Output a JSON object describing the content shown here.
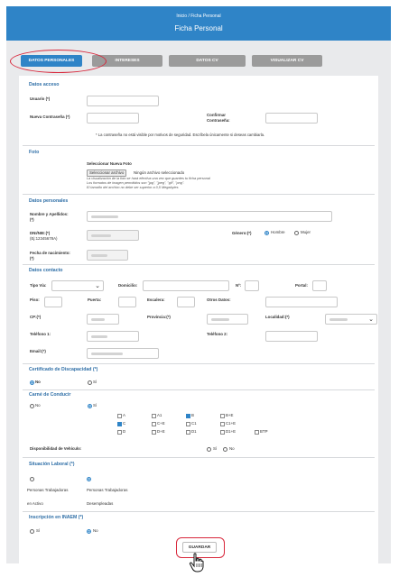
{
  "header": {
    "breadcrumb": "Inicio / Ficha Personal",
    "title": "Ficha Personal"
  },
  "tabs": [
    "DATOS PERSONALES",
    "INTERESES",
    "DATOS CV",
    "VISUALIZAR CV"
  ],
  "acceso": {
    "title": "Datos acceso",
    "usuario": "Usuario (*)",
    "nueva": "Nueva Contraseña (*)",
    "confirmar_1": "Confirmar",
    "confirmar_2": "Contraseña:",
    "note": "* La contraseña no está visible por motivos de seguridad. Escríbela únicamente si deseas cambiarla."
  },
  "foto": {
    "title": "Foto",
    "select_label": "Seleccionar Nueva Foto",
    "button": "Seleccionar archivo",
    "no_file": "Ningún archivo seleccionado",
    "hint_1": "La visualización de la foto se hará efectiva una vez que guardes tu ficha personal",
    "hint_2": "Los formatos de imagen permitidos son \"jpg\", \"jpeg\", \"gif\", \"png\".",
    "hint_3": "El tamaño del archivo no debe ser superior a 0,5 Megabytes"
  },
  "personales": {
    "title": "Datos personales",
    "nombre_1": "Nombre y Apellidos:",
    "nombre_2": "(*)",
    "dni_1": "DNI/NIE:(*)",
    "dni_2": "(Ej:12345678A)",
    "genero": "Género:(*)",
    "hombre": "Hombre",
    "mujer": "Mujer",
    "fecha_1": "Fecha de nacimiento:",
    "fecha_2": "(*)"
  },
  "contacto": {
    "title": "Datos contacto",
    "tipo_via": "Tipo Vía:",
    "domicilio": "Domicilio:",
    "num": "Nº:",
    "portal": "Portal:",
    "piso": "Piso:",
    "puerta": "Puerta:",
    "escalera": "Escalera:",
    "otros": "Otros Datos:",
    "cp": "CP:(*)",
    "provincia": "Provincia:(*)",
    "localidad": "Localidad:(*)",
    "tel1": "Teléfono 1:",
    "tel2": "Teléfono 2:",
    "email": "Email:(*)"
  },
  "discapacidad": {
    "title": "Certificado de Discapacidad (*)",
    "no": "No",
    "si": "Sí"
  },
  "carne": {
    "title": "Carné de Conducir",
    "no": "No",
    "si": "Sí",
    "options": [
      "A",
      "A1",
      "B",
      "B+E",
      "C",
      "C+E",
      "C1",
      "C1+E",
      "D",
      "D+E",
      "D1",
      "D1+E",
      "BTP"
    ],
    "vehiculo": "Disponibilidad de Vehículo:",
    "veh_si": "Sí",
    "veh_no": "No"
  },
  "laboral": {
    "title": "Situación Laboral (*)",
    "opt1_a": "Personas Trabajadoras",
    "opt1_b": "en Activo",
    "opt2_a": "Personas Trabajadoras",
    "opt2_b": "Desempleadas"
  },
  "inaem": {
    "title": "Inscripción en INAEM (*)",
    "si": "Sí",
    "no": "No"
  },
  "save": "GUARDAR"
}
